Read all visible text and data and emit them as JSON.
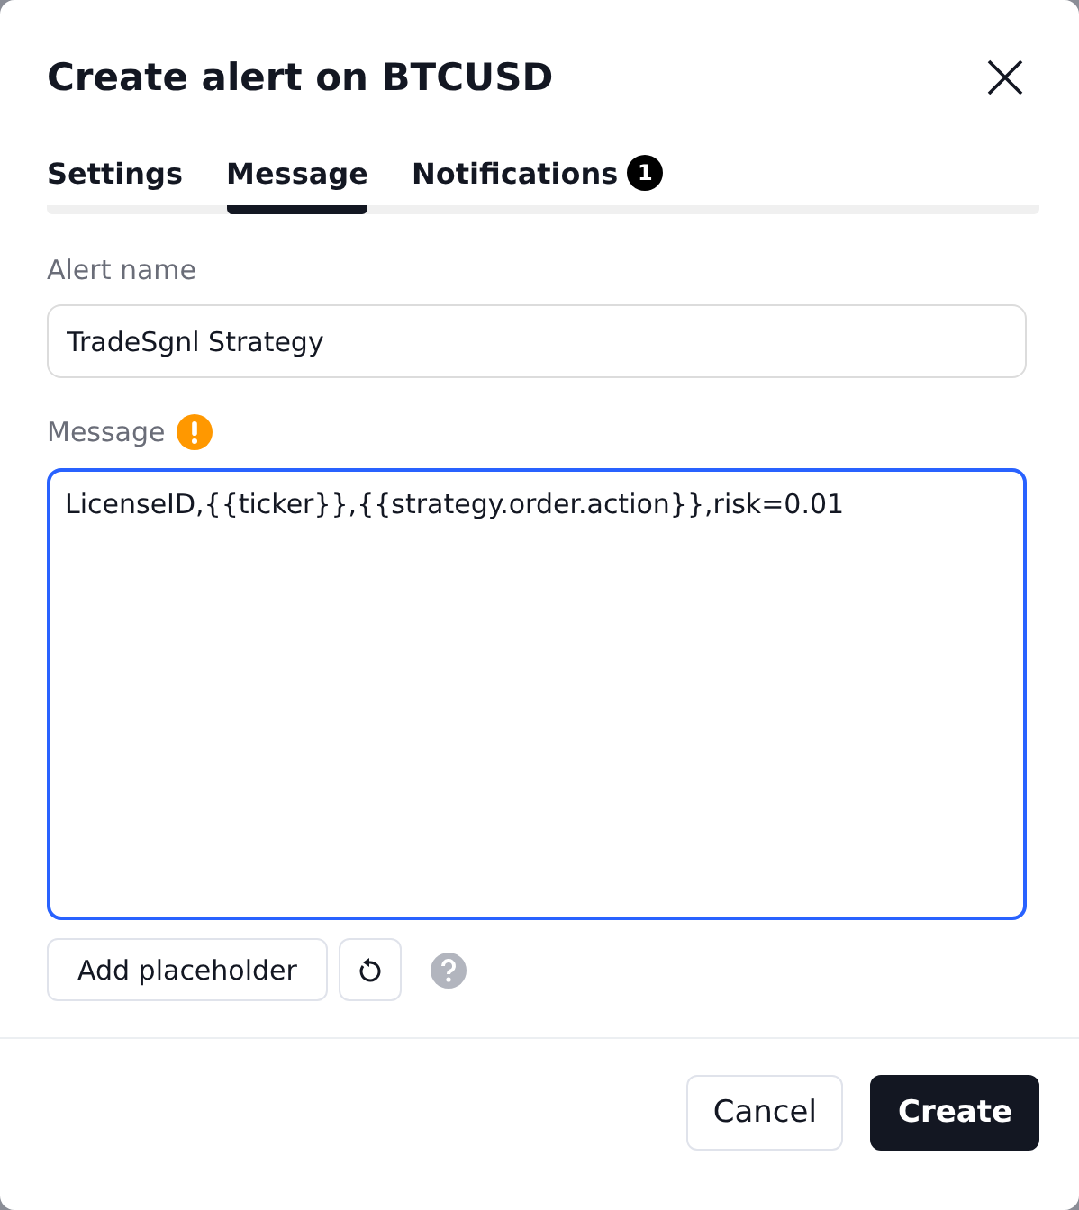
{
  "dialog": {
    "title": "Create alert on BTCUSD"
  },
  "tabs": [
    {
      "label": "Settings",
      "selected": false
    },
    {
      "label": "Message",
      "selected": true
    },
    {
      "label": "Notifications",
      "selected": false,
      "badge": "1"
    }
  ],
  "alert_name": {
    "label": "Alert name",
    "value": "TradeSgnl Strategy"
  },
  "message": {
    "label": "Message",
    "warning": true,
    "value": "LicenseID,{{ticker}},{{strategy.order.action}},risk=0.01"
  },
  "add_placeholder": "Add placeholder",
  "buttons": [
    {
      "label": "Cancel",
      "kind": "secondary"
    },
    {
      "label": "Create",
      "kind": "primary"
    }
  ]
}
